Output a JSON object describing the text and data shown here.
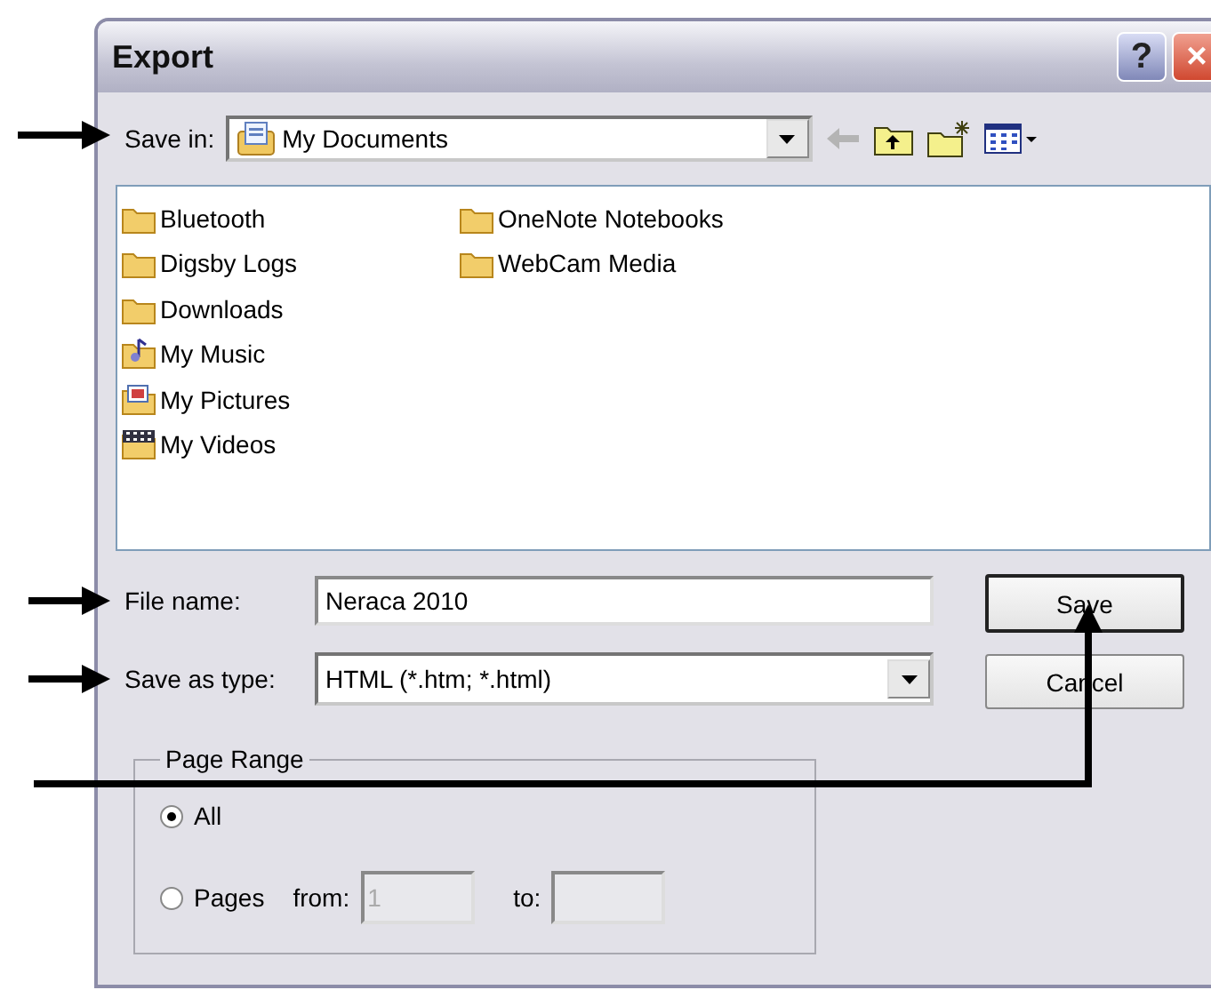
{
  "window": {
    "title": "Export",
    "help_button": "?",
    "close_button": "×"
  },
  "save_in": {
    "label": "Save in:",
    "value": "My Documents"
  },
  "files": [
    {
      "name": "Bluetooth",
      "kind": "folder"
    },
    {
      "name": "Digsby Logs",
      "kind": "folder"
    },
    {
      "name": "Downloads",
      "kind": "folder"
    },
    {
      "name": "My Music",
      "kind": "music"
    },
    {
      "name": "My Pictures",
      "kind": "pictures"
    },
    {
      "name": "My Videos",
      "kind": "videos"
    },
    {
      "name": "OneNote Notebooks",
      "kind": "folder"
    },
    {
      "name": "WebCam Media",
      "kind": "folder"
    }
  ],
  "file_name": {
    "label": "File name:",
    "value": "Neraca 2010"
  },
  "save_as_type": {
    "label": "Save as type:",
    "value": "HTML (*.htm; *.html)"
  },
  "buttons": [
    {
      "label": "Save",
      "default": true
    },
    {
      "label": "Cancel",
      "default": false
    }
  ],
  "page_range": {
    "title": "Page Range",
    "options": [
      {
        "label": "All",
        "selected": true
      },
      {
        "label": "Pages",
        "selected": false
      }
    ],
    "from_label": "from:",
    "from_value": "1",
    "to_label": "to:"
  }
}
